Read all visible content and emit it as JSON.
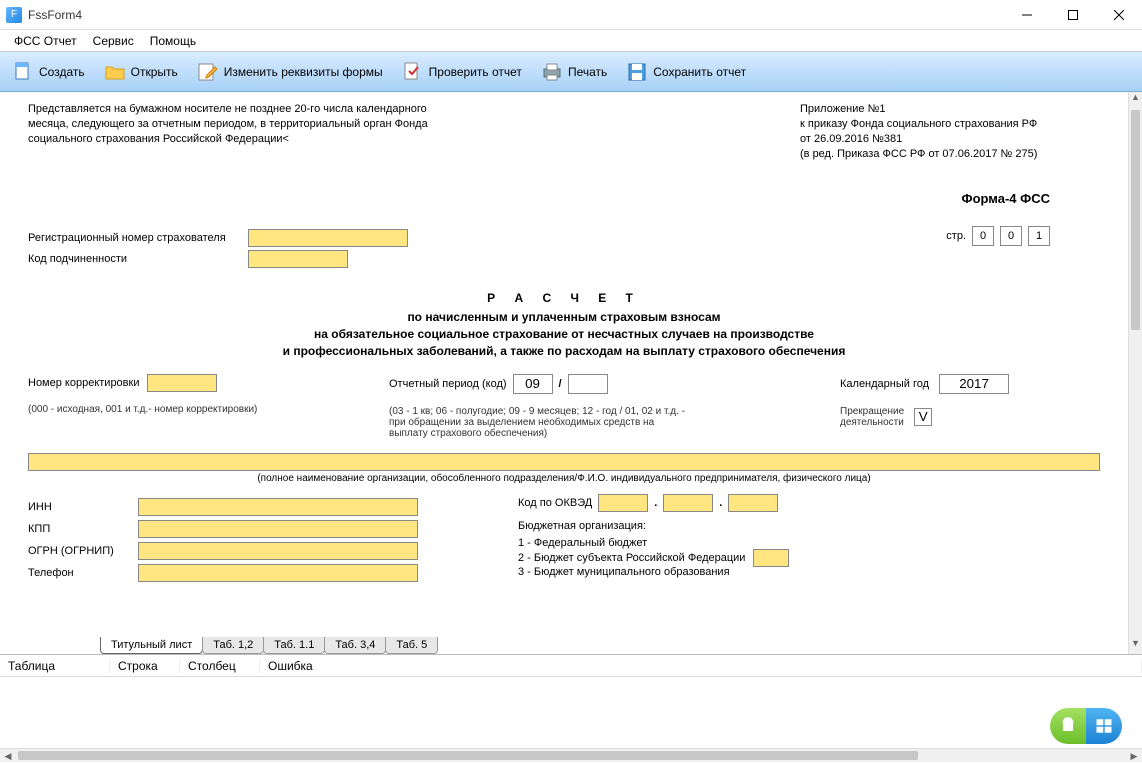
{
  "window": {
    "title": "FssForm4"
  },
  "menu": {
    "items": [
      "ФСС Отчет",
      "Сервис",
      "Помощь"
    ]
  },
  "toolbar": {
    "create": "Создать",
    "open": "Открыть",
    "edit_props": "Изменить реквизиты формы",
    "check": "Проверить отчет",
    "print": "Печать",
    "save": "Сохранить отчет"
  },
  "doc": {
    "left_note": "Представляется на бумажном носителе не позднее 20-го числа календарного месяца, следующего за отчетным периодом, в территориальный орган Фонда социального страхования Российской Федерации<",
    "right_note_l1": "Приложение №1",
    "right_note_l2": "к приказу Фонда социального страхования РФ",
    "right_note_l3": "от 26.09.2016 №381",
    "right_note_l4": "(в ред. Приказа ФСС РФ от 07.06.2017 № 275)",
    "form_title": "Форма-4 ФСС",
    "reg_num_label": "Регистрационный номер страхователя",
    "sub_code_label": "Код подчиненности",
    "page_label": "стр.",
    "page_cells": [
      "0",
      "0",
      "1"
    ],
    "big_title": "Р А С Ч Е Т",
    "sub1": "по начисленным и уплаченным страховым взносам",
    "sub2": "на обязательное социальное страхование от несчастных случаев на производстве",
    "sub3": "и профессиональных заболеваний, а также по расходам на выплату страхового обеспечения",
    "corr_label": "Номер корректировки",
    "corr_hint": "(000 - исходная, 001 и т.д.- номер корректировки)",
    "per_label": "Отчетный период (код)",
    "per1": "09",
    "per_sep": "/",
    "per2": "",
    "per_hint": "(03 - 1 кв; 06 - полугодие; 09 - 9 месяцев; 12 - год / 01, 02 и т.д. - при обращении за выделением необходимых средств на выплату страхового обеспечения)",
    "year_label": "Календарный год",
    "year_val": "2017",
    "stop_label1": "Прекращение",
    "stop_label2": "деятельности",
    "stop_val": "V",
    "org_hint": "(полное наименование организации, обособленного подразделения/Ф.И.О. индивидуального предпринимателя, физического лица)",
    "inn": "ИНН",
    "kpp": "КПП",
    "ogrn": "ОГРН (ОГРНИП)",
    "tel": "Телефон",
    "okved": "Код по ОКВЭД",
    "budget_title": "Бюджетная организация:",
    "budget1": "1 - Федеральный бюджет",
    "budget2": "2 - Бюджет субъекта Российской Федерации",
    "budget3": "3 - Бюджет муниципального образования"
  },
  "tabs": [
    "Титульный лист",
    "Таб. 1,2",
    "Таб. 1.1",
    "Таб. 3,4",
    "Таб. 5"
  ],
  "bottom_headers": [
    "Таблица",
    "Строка",
    "Столбец",
    "Ошибка"
  ]
}
